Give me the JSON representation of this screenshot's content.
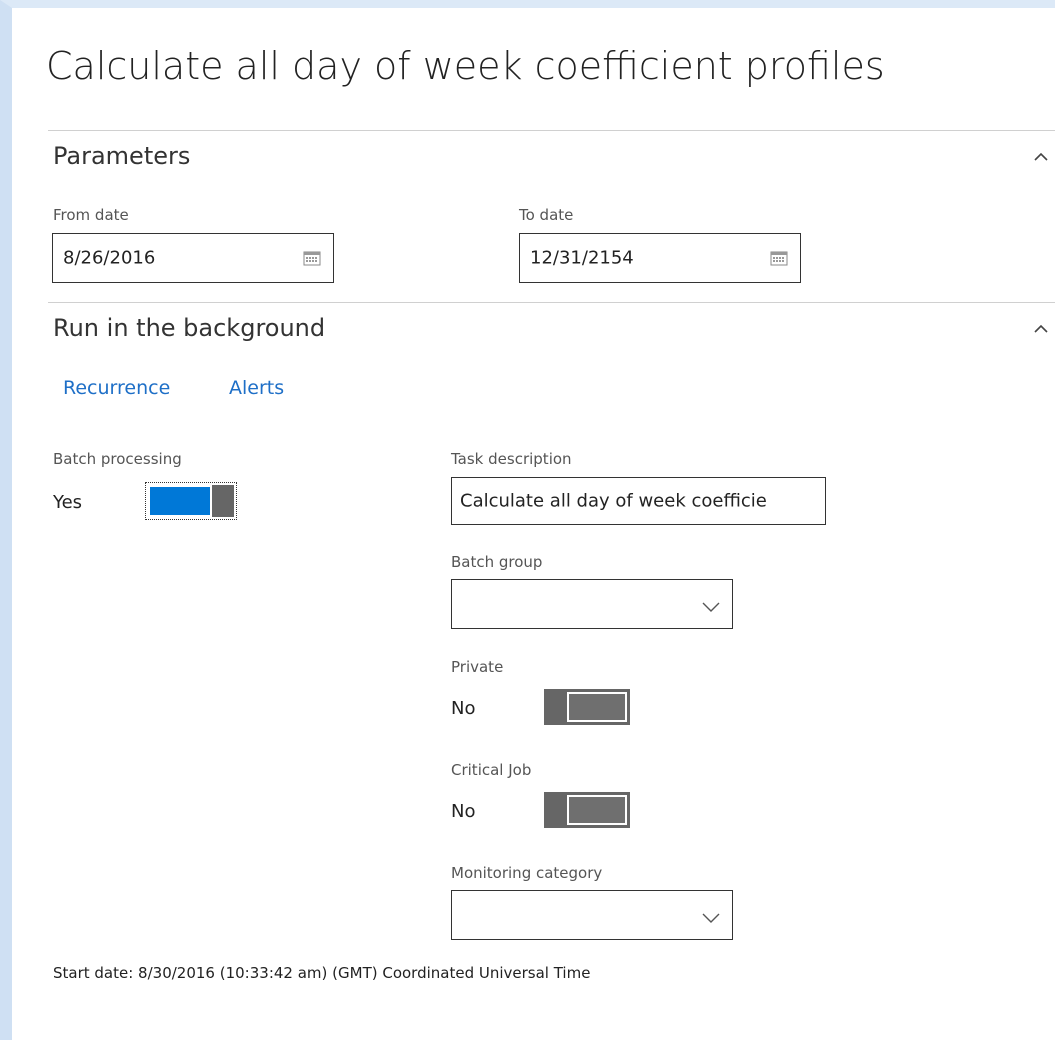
{
  "page": {
    "title": "Calculate all day of week coefficient profiles"
  },
  "parameters": {
    "heading": "Parameters",
    "from_date_label": "From date",
    "from_date_value": "8/26/2016",
    "to_date_label": "To date",
    "to_date_value": "12/31/2154"
  },
  "background": {
    "heading": "Run in the background",
    "links": {
      "recurrence": "Recurrence",
      "alerts": "Alerts"
    },
    "batch_processing_label": "Batch processing",
    "batch_processing_value": "Yes",
    "task_description_label": "Task description",
    "task_description_value": "Calculate all day of week coefficie",
    "batch_group_label": "Batch group",
    "batch_group_value": "",
    "private_label": "Private",
    "private_value": "No",
    "critical_job_label": "Critical Job",
    "critical_job_value": "No",
    "monitoring_category_label": "Monitoring category",
    "monitoring_category_value": "",
    "start_date_text": "Start date: 8/30/2016 (10:33:42 am) (GMT) Coordinated Universal Time"
  },
  "colors": {
    "accent": "#0078d7",
    "link": "#1e6fc7",
    "toggle_off": "#666666"
  },
  "icons": {
    "calendar": "calendar-icon",
    "collapse": "chevron-up-icon",
    "dropdown": "chevron-down-icon"
  }
}
